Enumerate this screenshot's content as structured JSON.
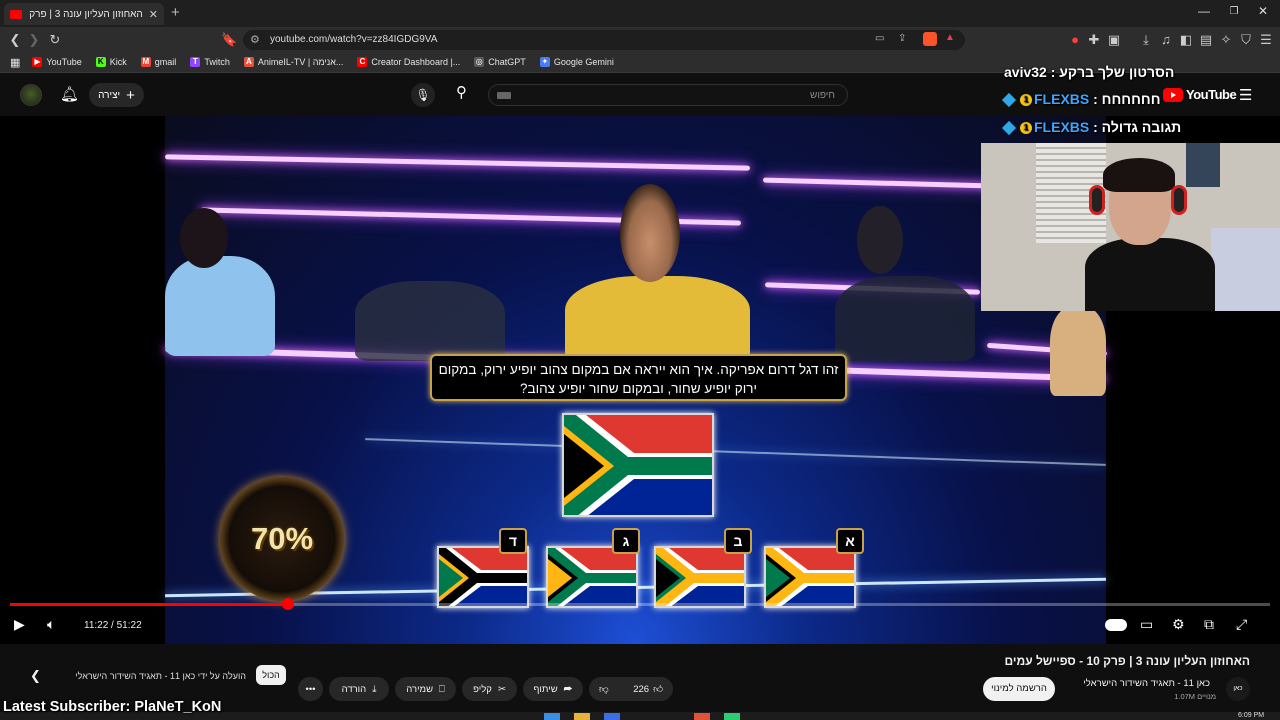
{
  "browser": {
    "tab_title": "האחוזון העליון עונה 3 | פרק 10 -",
    "url": "youtube.com/watch?v=zz84IGDG9VA",
    "bookmarks": [
      {
        "label": "YouTube",
        "color": "#ff0000",
        "glyph": "▶"
      },
      {
        "label": "Kick",
        "color": "#53fc18",
        "glyph": "K"
      },
      {
        "label": "gmail",
        "color": "#ea4335",
        "glyph": "M"
      },
      {
        "label": "Twitch",
        "color": "#9146ff",
        "glyph": "T"
      },
      {
        "label": "AnimeIL-TV | אנימה...",
        "color": "#e5533d",
        "glyph": "A"
      },
      {
        "label": "Creator Dashboard |...",
        "color": "#ff0000",
        "glyph": "C"
      },
      {
        "label": "ChatGPT",
        "color": "#5a5a5a",
        "glyph": "◎"
      },
      {
        "label": "Google Gemini",
        "color": "#4a7cf7",
        "glyph": "✦"
      }
    ]
  },
  "youtube": {
    "create_label": "יצירה",
    "search_placeholder": "חיפוש",
    "logo_text": "YouTube"
  },
  "stream_overlay": {
    "latest_video": "הסרטון שלך ברקע : aviv32",
    "alert1_text": "חחחחחח : ",
    "alert1_name": "FLEXBS",
    "alert2_text": "תגובה גדולה : ",
    "alert2_name": "FLEXBS",
    "latest_subscriber": "Latest Subscriber: PlaNeT_KoN"
  },
  "video": {
    "question": "זהו דגל דרום אפריקה. איך הוא ייראה אם במקום צהוב יופיע ירוק, במקום ירוק יופיע שחור, ובמקום שחור יופיע צהוב?",
    "answer_letters": [
      "ד",
      "ג",
      "ב",
      "א"
    ],
    "percent": "70%",
    "current_time": "11:22",
    "duration": "51:22",
    "time_display": "11:22 / 51:22",
    "progress_fraction": 0.221
  },
  "below_video": {
    "title": "האחוזון העליון עונה 3 | פרק 10 - ספיישל עמים",
    "channel_name": "כאן 11 - תאגיד השידור הישראלי",
    "channel_subs": "1.07M מנויים",
    "channel_avatar_text": "כאן",
    "subscribe_label": "הרשמה למינוי",
    "likes": "226",
    "share_label": "שיתוף",
    "clip_label": "קליפ",
    "save_label": "שמירה",
    "download_label": "הורדה",
    "chip_all": "הכול",
    "chip_uploaded": "הועלה על ידי כאן 11 - תאגיד השידור הישראלי"
  },
  "system": {
    "clock": "6:09 PM"
  }
}
